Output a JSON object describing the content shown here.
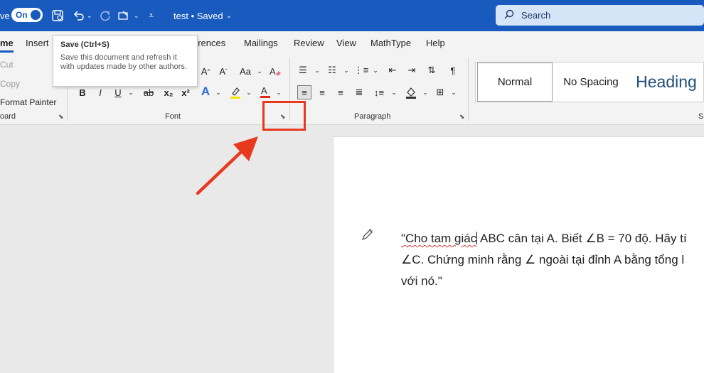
{
  "titlebar": {
    "autosave_label": "ve",
    "autosave_state": "On",
    "doc_name": "test",
    "doc_status": "• Saved",
    "search_placeholder": "Search"
  },
  "tabs": [
    "me",
    "Insert",
    "erences",
    "Mailings",
    "Review",
    "View",
    "MathType",
    "Help"
  ],
  "active_tab": "me",
  "tooltip": {
    "title": "Save (Ctrl+S)",
    "body": "Save this document and refresh it with updates made by other authors."
  },
  "clipboard": {
    "cut": "Cut",
    "copy": "Copy",
    "format_painter": "Format Painter",
    "group_label": "oard"
  },
  "font_group": {
    "label": "Font",
    "bold": "B",
    "italic": "I",
    "underline": "U",
    "strike": "ab",
    "subscript": "x₂",
    "superscript": "x²",
    "grow": "A^",
    "shrink": "A˅",
    "change_case": "Aa"
  },
  "paragraph_group": {
    "label": "Paragraph"
  },
  "styles": {
    "normal": "Normal",
    "no_spacing": "No Spacing",
    "heading": "Heading",
    "group_label_fragment": "S"
  },
  "document": {
    "line1_a": "\"Cho tam giác",
    "line1_b": " ABC cân tại A. Biết ∠B = 70 độ. Hãy tí",
    "line2": "∠C. Chứng minh rằng ∠ ngoài tại đỉnh A bằng tổng l",
    "line3": "với nó.\""
  },
  "colors": {
    "title_blue": "#185abd",
    "annotation_red": "#e8391f"
  }
}
